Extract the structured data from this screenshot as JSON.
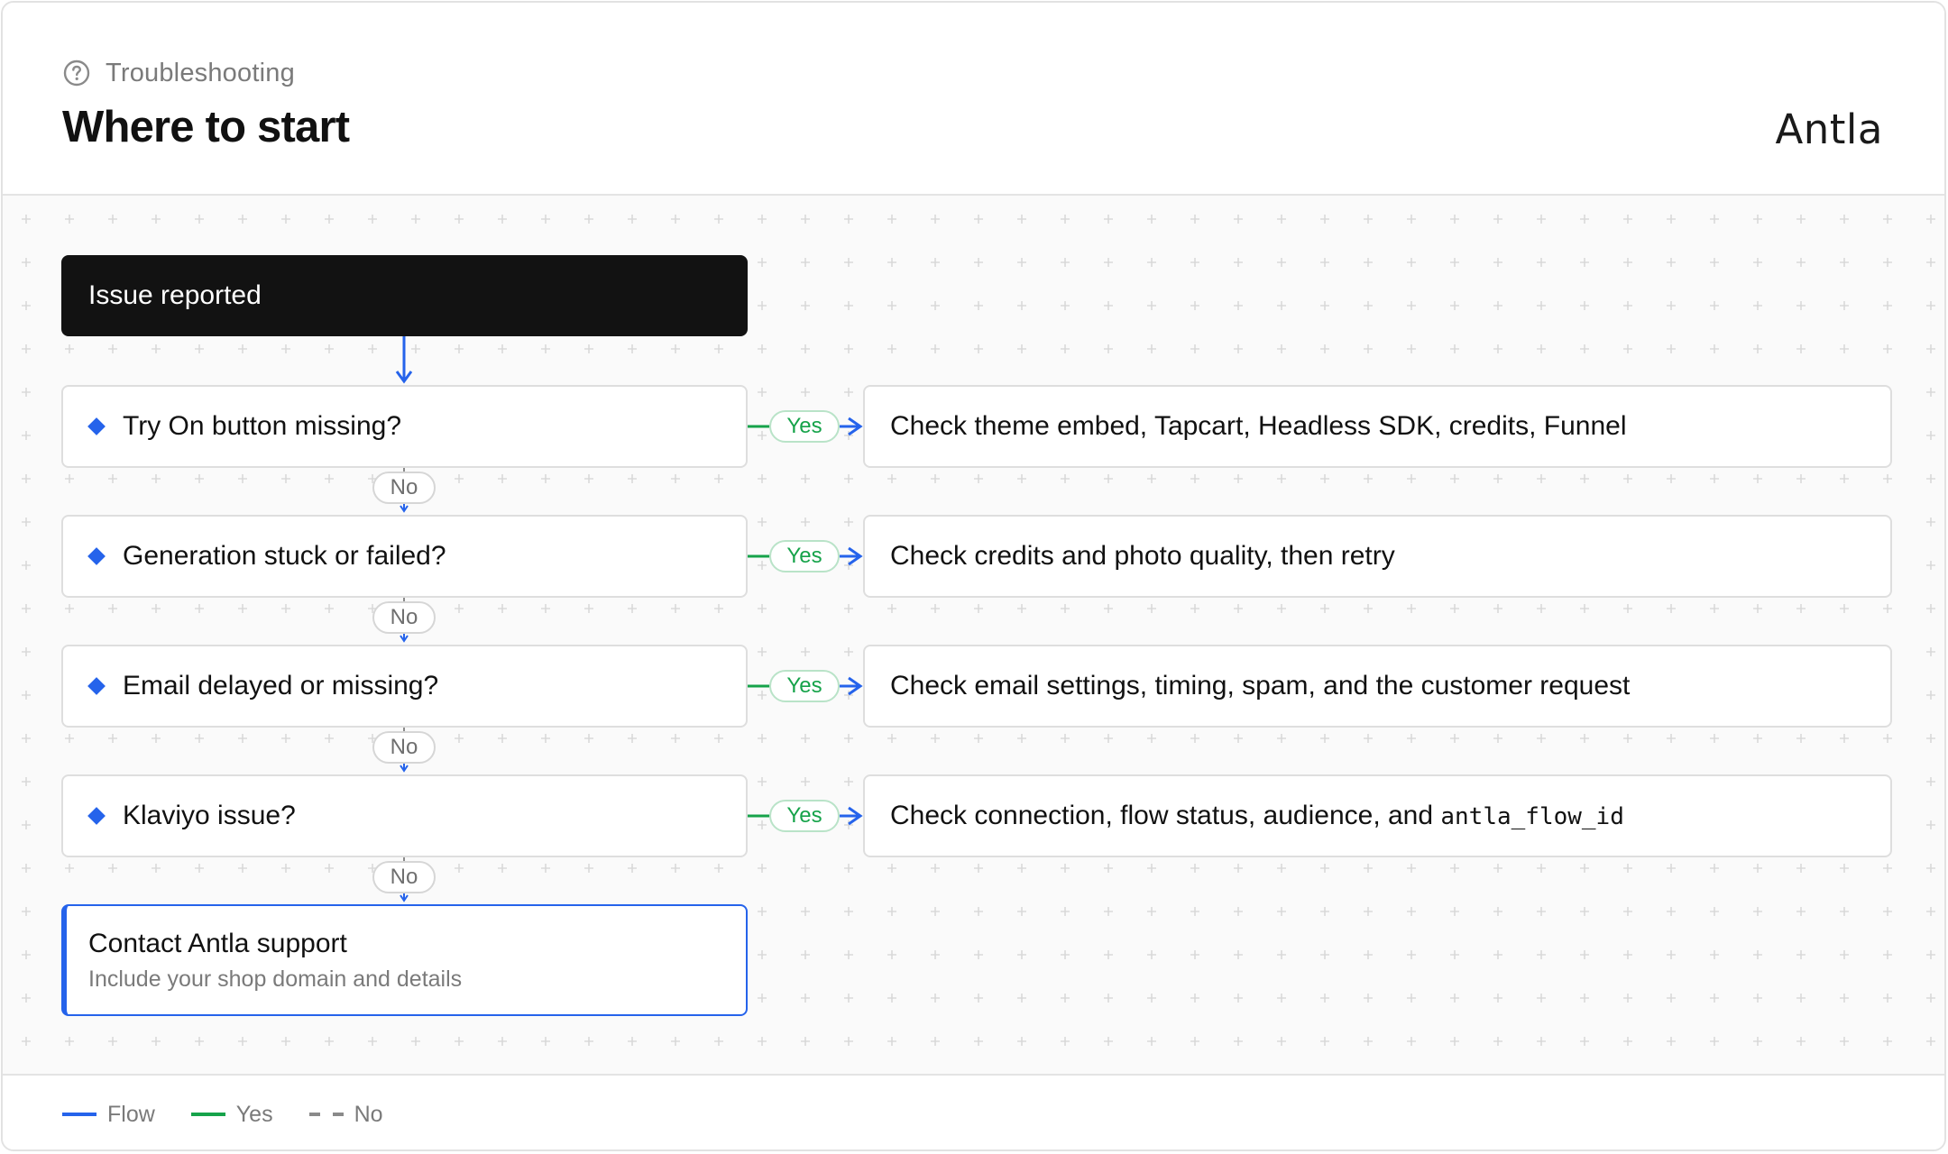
{
  "header": {
    "eyebrow": "Troubleshooting",
    "title": "Where to start",
    "brand": "Antla"
  },
  "start": {
    "label": "Issue reported"
  },
  "steps": [
    {
      "question": "Try On button missing?",
      "answer": "Check theme embed, Tapcart, Headless SDK, credits, Funnel"
    },
    {
      "question": "Generation stuck or failed?",
      "answer": "Check credits and photo quality, then retry"
    },
    {
      "question": "Email delayed or missing?",
      "answer": "Check email settings, timing, spam, and the customer request"
    },
    {
      "question": "Klaviyo issue?",
      "answer": "Check connection, flow status, audience, and ",
      "answer_code": "antla_flow_id"
    }
  ],
  "yes_label": "Yes",
  "no_label": "No",
  "end": {
    "title": "Contact Antla support",
    "subtitle": "Include your shop domain and details"
  },
  "legend": {
    "flow": "Flow",
    "yes": "Yes",
    "no": "No"
  },
  "colors": {
    "flow": "#2563eb",
    "yes": "#16a34a",
    "no": "#8a8a8a",
    "start_fill": "#121212",
    "grid_plus": "#d9d9d9"
  },
  "icons": {
    "eyebrow_icon": "help-circle-icon",
    "question_marker": "diamond-icon"
  }
}
